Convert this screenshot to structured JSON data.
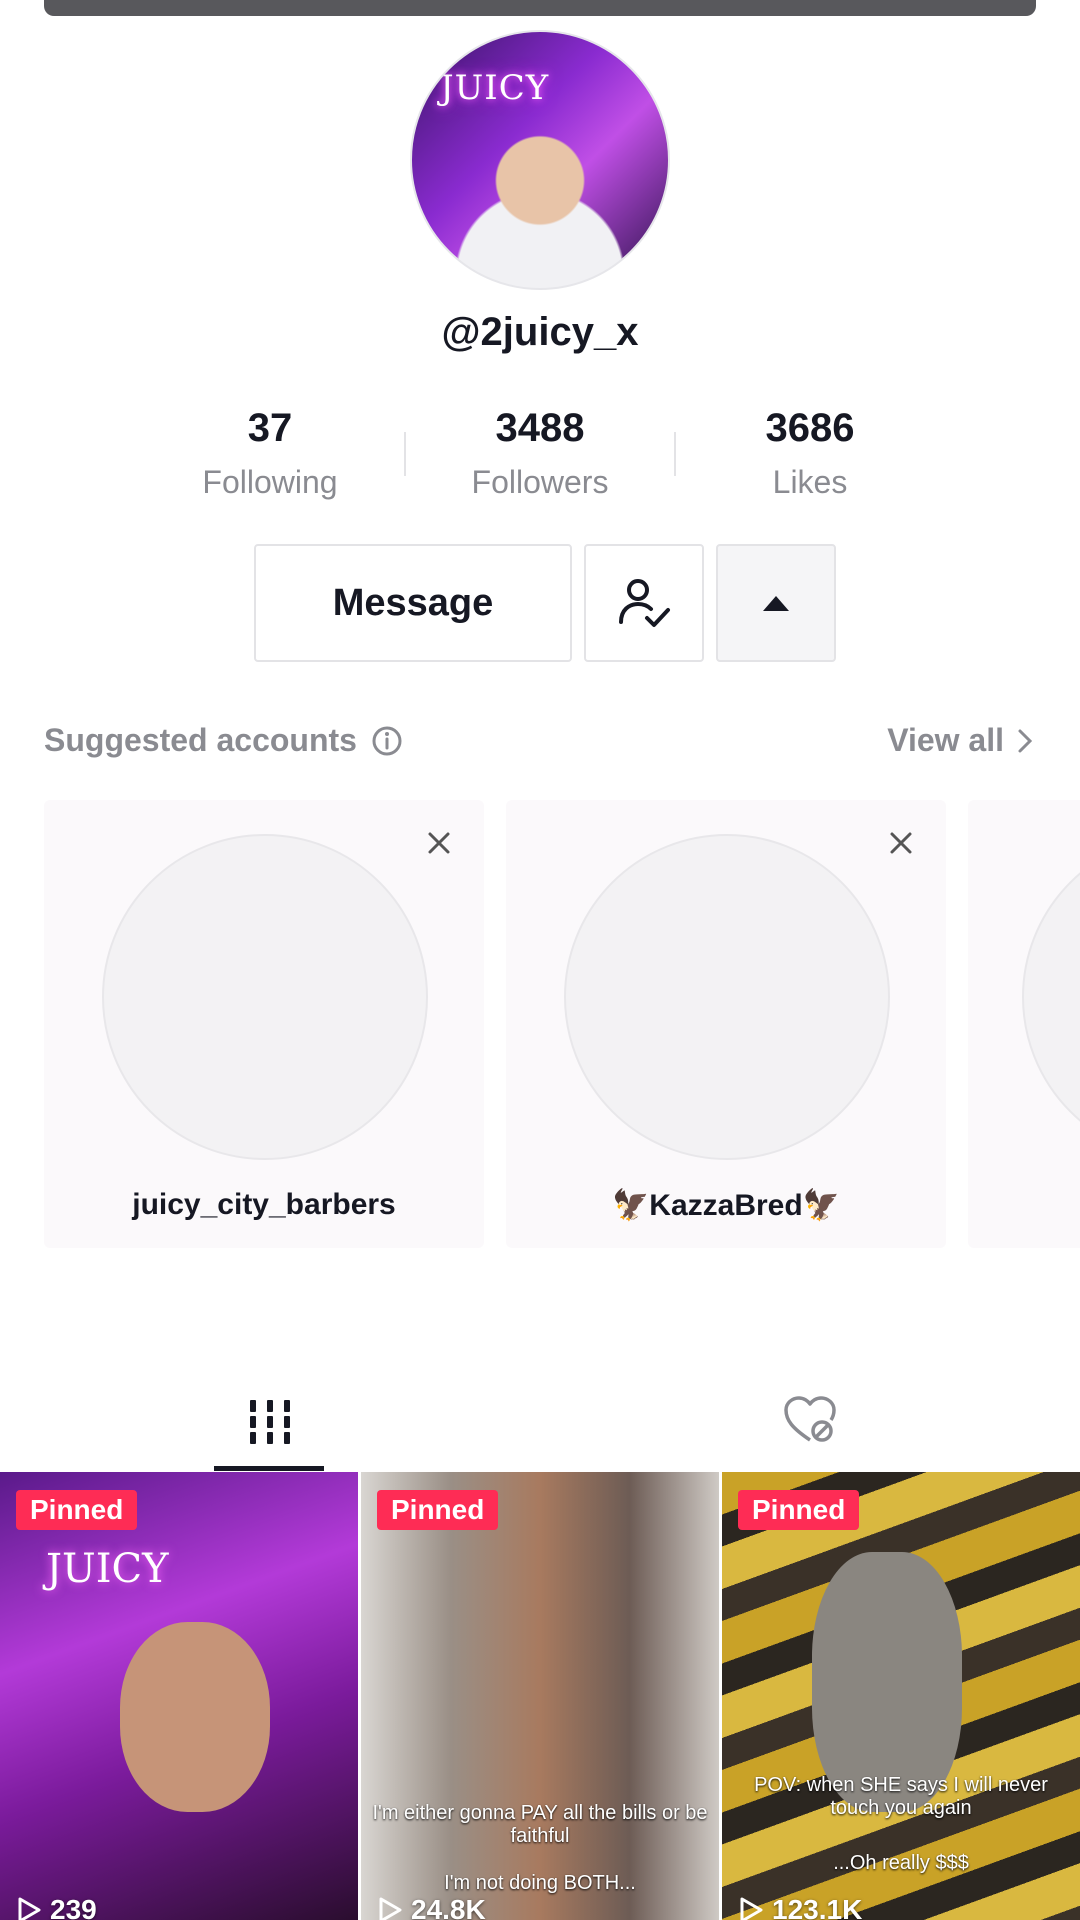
{
  "profile": {
    "username": "@2juicy_x",
    "avatar_sign": "JUICY",
    "stats": [
      {
        "value": "37",
        "label": "Following"
      },
      {
        "value": "3488",
        "label": "Followers"
      },
      {
        "value": "3686",
        "label": "Likes"
      }
    ]
  },
  "actions": {
    "message_label": "Message",
    "follow_icon": "user-check-icon",
    "more_icon": "caret-up-icon"
  },
  "suggested": {
    "title": "Suggested accounts",
    "view_all": "View all",
    "accounts": [
      {
        "name": "juicy_city_barbers"
      },
      {
        "name": "🦅KazzaBred🦅"
      }
    ]
  },
  "tabs": [
    {
      "icon": "videos-grid-icon",
      "selected": true
    },
    {
      "icon": "liked-hidden-icon",
      "selected": false
    }
  ],
  "videos": [
    {
      "badge": "Pinned",
      "views": "239",
      "sign": "JUICY",
      "caption": ""
    },
    {
      "badge": "Pinned",
      "views": "24.8K",
      "caption": "I'm either gonna PAY all the bills or be faithful",
      "caption2": "I'm not doing BOTH..."
    },
    {
      "badge": "Pinned",
      "views": "123.1K",
      "caption": "POV: when SHE says I will never touch you again",
      "caption2": "...Oh really $$$"
    }
  ],
  "colors": {
    "accent": "#fe2c55",
    "muted": "#8a8b91",
    "text": "#161823"
  }
}
